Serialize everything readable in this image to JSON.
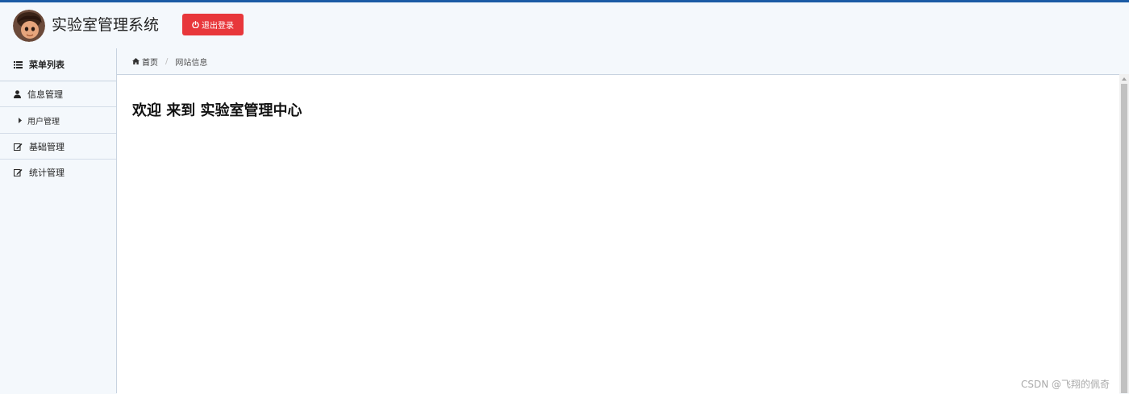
{
  "header": {
    "title": "实验室管理系统",
    "logout_label": "退出登录",
    "accent_color": "#1b5ba5",
    "logout_color": "#e8373b"
  },
  "sidebar": {
    "heading": "菜单列表",
    "items": [
      {
        "label": "信息管理",
        "icon": "user-icon",
        "children": [
          {
            "label": "用户管理",
            "icon": "caret-right-icon"
          }
        ]
      },
      {
        "label": "基础管理",
        "icon": "edit-icon"
      },
      {
        "label": "统计管理",
        "icon": "edit-icon"
      }
    ]
  },
  "breadcrumb": {
    "home": "首页",
    "separator": "/",
    "current": "网站信息"
  },
  "main": {
    "welcome": "欢迎 来到 实验室管理中心"
  },
  "watermark": "CSDN @飞翔的佩奇"
}
